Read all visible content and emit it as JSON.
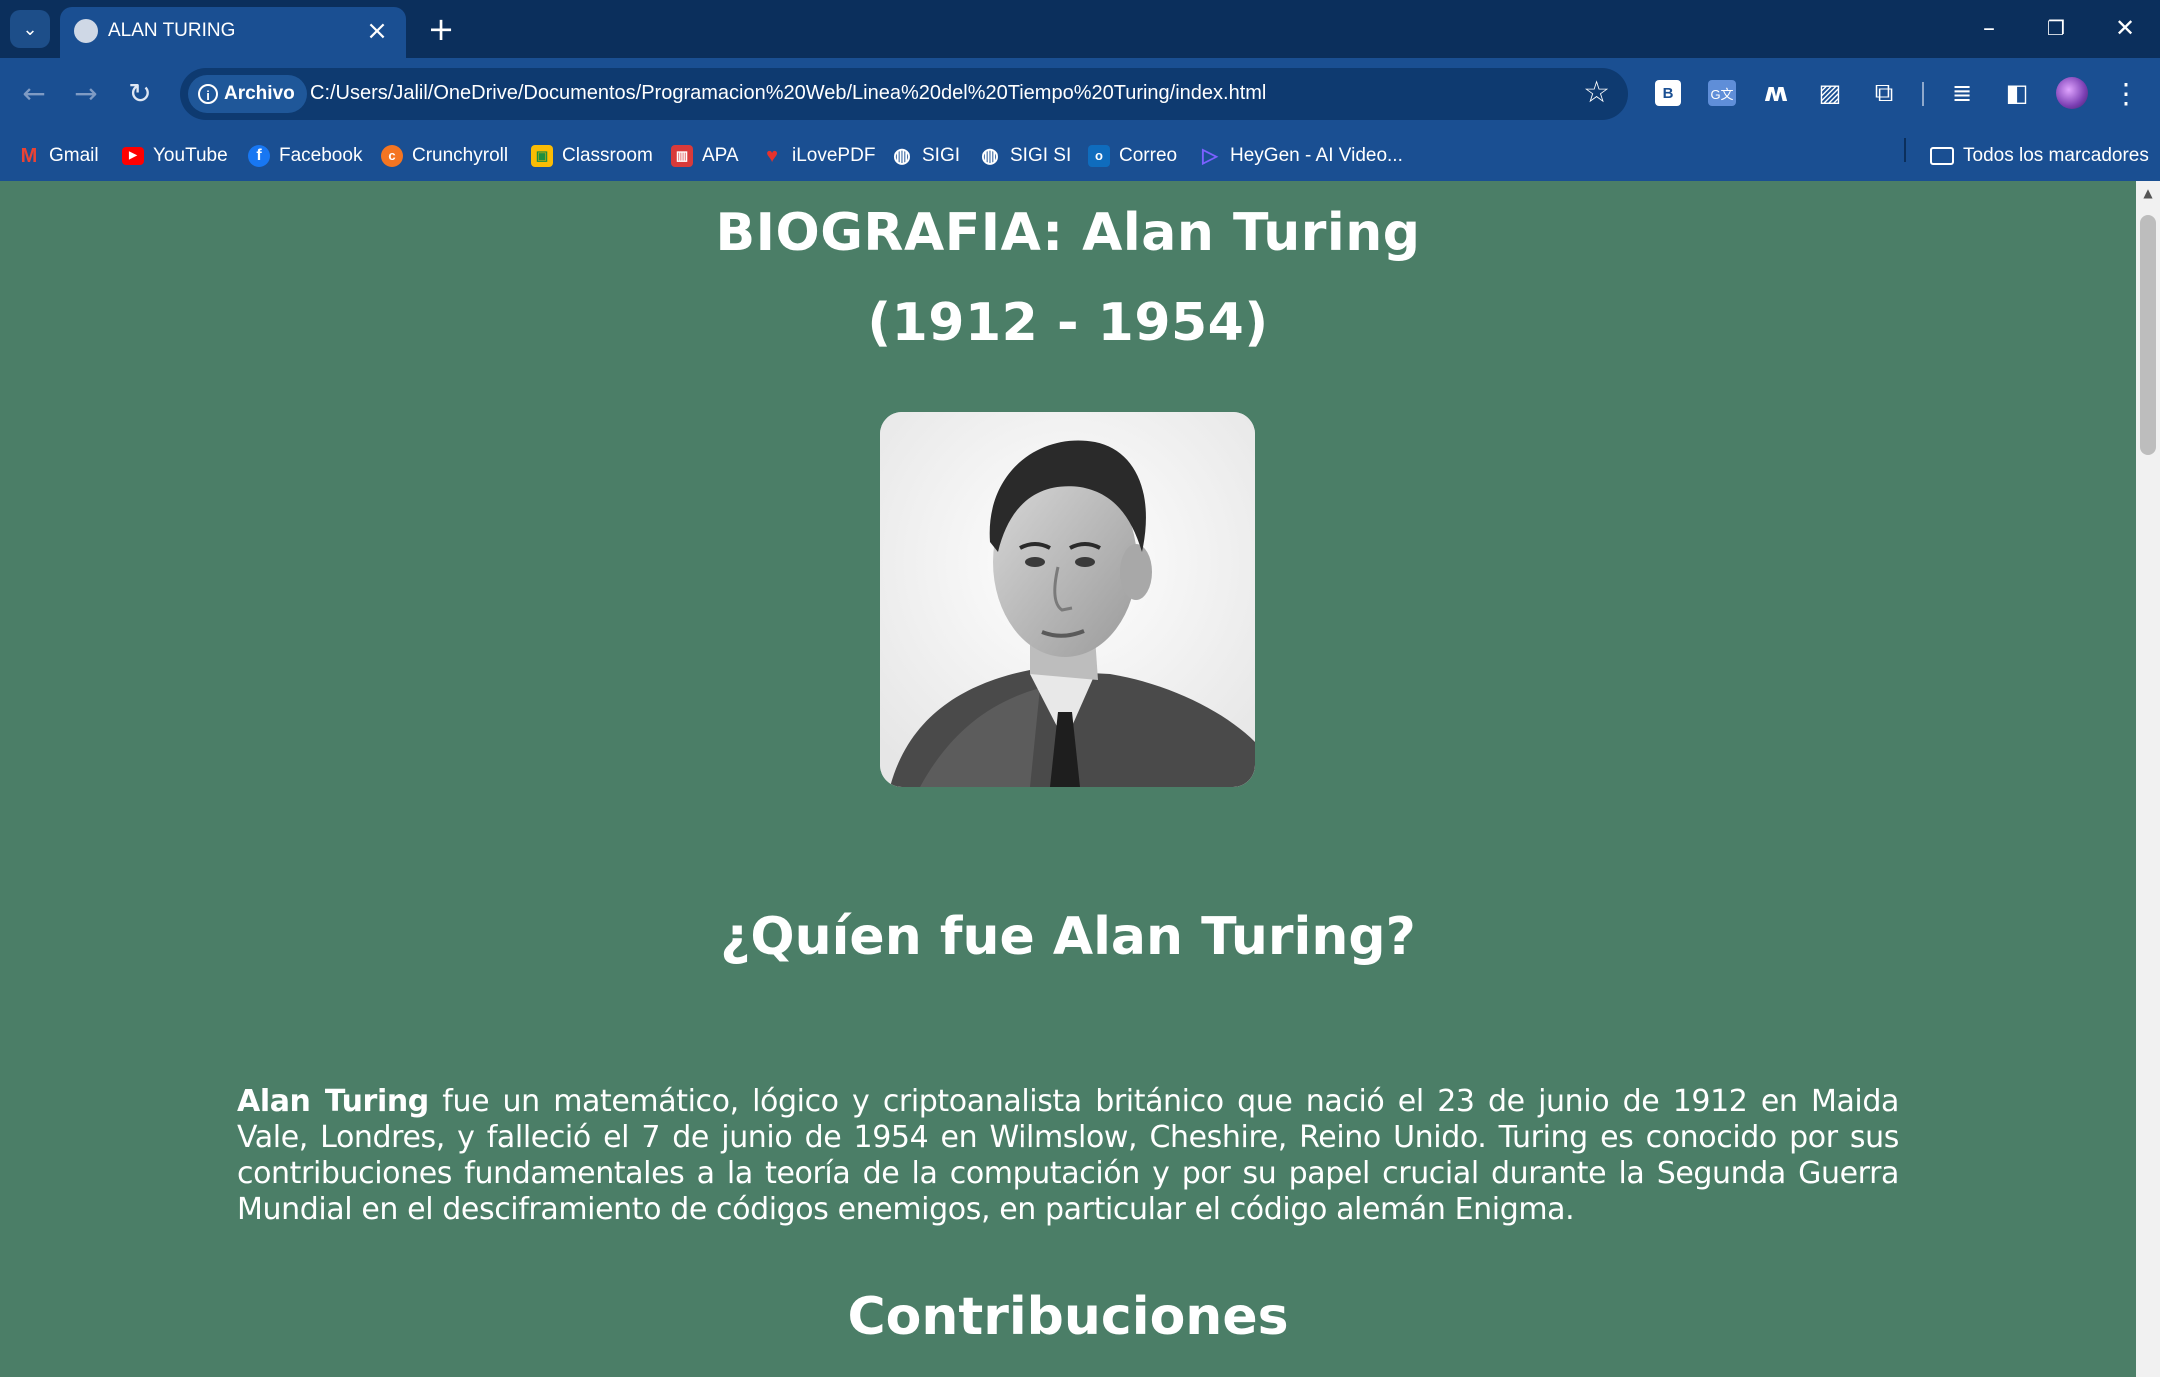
{
  "browser": {
    "tab_title": "ALAN TURING",
    "address_chip": "Archivo",
    "url": "C:/Users/Jalil/OneDrive/Documentos/Programacion%20Web/Linea%20del%20Tiempo%20Turing/index.html",
    "bookmarks": [
      {
        "label": "Gmail",
        "icon": "gmail-icon",
        "color": "#ea4335"
      },
      {
        "label": "YouTube",
        "icon": "youtube-icon",
        "color": "#ff0000"
      },
      {
        "label": "Facebook",
        "icon": "facebook-icon",
        "color": "#1877f2"
      },
      {
        "label": "Crunchyroll",
        "icon": "crunchyroll-icon",
        "color": "#f47521"
      },
      {
        "label": "Classroom",
        "icon": "classroom-icon",
        "color": "#fbbc04"
      },
      {
        "label": "APA",
        "icon": "book-icon",
        "color": "#d93a3a"
      },
      {
        "label": "iLovePDF",
        "icon": "ilovepdf-icon",
        "color": "#e5322d"
      },
      {
        "label": "SIGI",
        "icon": "globe-icon",
        "color": "#ffffff"
      },
      {
        "label": "SIGI SI",
        "icon": "globe-icon",
        "color": "#ffffff"
      },
      {
        "label": "Correo",
        "icon": "outlook-icon",
        "color": "#0f6cbd"
      },
      {
        "label": "HeyGen - AI Video...",
        "icon": "heygen-icon",
        "color": "#7b61ff"
      }
    ],
    "all_bookmarks": "Todos los marcadores"
  },
  "page": {
    "title": "BIOGRAFIA: Alan Turing",
    "years": "(1912 - 1954)",
    "section1_heading": "¿Quíen fue Alan Turing?",
    "intro_name": "Alan Turing",
    "intro_text": " fue un matemático, lógico y criptoanalista británico que nació el 23 de junio de 1912 en Maida Vale, Londres, y falleció el 7 de junio de 1954 en Wilmslow, Cheshire, Reino Unido. Turing es conocido por sus contribuciones fundamentales a la teoría de la computación y por su papel crucial durante la Segunda Guerra Mundial en el desciframiento de códigos enemigos, en particular el código alemán Enigma.",
    "section2_heading": "Contribuciones"
  },
  "colors": {
    "page_background": "#4b7e67",
    "browser_frame": "#0b2f5c",
    "toolbar": "#1a4f92"
  }
}
